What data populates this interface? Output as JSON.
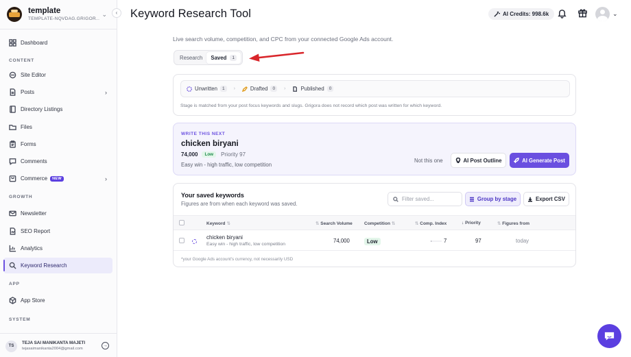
{
  "workspace": {
    "name": "template",
    "subtitle": "TEMPLATE-NQVDAG.GRIGOR..."
  },
  "sidebar": {
    "top_items": [
      {
        "label": "Dashboard",
        "icon": "dashboard-icon"
      }
    ],
    "sections": [
      {
        "label": "CONTENT",
        "items": [
          {
            "label": "Site Editor",
            "icon": "site-editor-icon"
          },
          {
            "label": "Posts",
            "icon": "posts-icon",
            "has_submenu": true
          },
          {
            "label": "Directory Listings",
            "icon": "directory-icon"
          },
          {
            "label": "Files",
            "icon": "folder-icon"
          },
          {
            "label": "Forms",
            "icon": "forms-icon"
          },
          {
            "label": "Comments",
            "icon": "comments-icon"
          },
          {
            "label": "Commerce",
            "icon": "commerce-icon",
            "badge": "NEW",
            "has_submenu": true
          }
        ]
      },
      {
        "label": "GROWTH",
        "items": [
          {
            "label": "Newsletter",
            "icon": "mail-icon"
          },
          {
            "label": "SEO Report",
            "icon": "seo-report-icon"
          },
          {
            "label": "Analytics",
            "icon": "analytics-icon"
          },
          {
            "label": "Keyword Research",
            "icon": "search-icon",
            "active": true
          }
        ]
      },
      {
        "label": "APP",
        "items": [
          {
            "label": "App Store",
            "icon": "app-store-icon"
          }
        ]
      },
      {
        "label": "SYSTEM",
        "items": []
      }
    ],
    "user": {
      "initials": "TS",
      "name": "TEJA SAI MANIKANTA MAJETI",
      "email": "tejasaimanikanta2004@gmail.com"
    }
  },
  "header": {
    "title": "Keyword Research Tool",
    "credits": "AI Credits: 998.6k"
  },
  "subtitle": "Live search volume, competition, and CPC from your connected Google Ads account.",
  "tabs": [
    {
      "label": "Research"
    },
    {
      "label": "Saved",
      "count": "1",
      "active": true
    }
  ],
  "stages": {
    "items": [
      {
        "label": "Unwritten",
        "count": "1"
      },
      {
        "label": "Drafted",
        "count": "0"
      },
      {
        "label": "Published",
        "count": "0"
      }
    ],
    "note": "Stage is matched from your post focus keywords and slugs. Grigora does not record which post was written for which keyword."
  },
  "next": {
    "eyebrow": "WRITE THIS NEXT",
    "keyword": "chicken biryani",
    "volume": "74,000",
    "competition": "Low",
    "priority": "Priority 97",
    "description": "Easy win - high traffic, low competition",
    "not_this": "Not this one",
    "outline_label": "AI Post Outline",
    "generate_label": "AI Generate Post"
  },
  "saved": {
    "title": "Your saved keywords",
    "subtitle": "Figures are from when each keyword was saved.",
    "filter_placeholder": "Filter saved...",
    "group_label": "Group by stage",
    "export_label": "Export CSV",
    "columns": [
      "Keyword",
      "Search Volume",
      "Competition",
      "Comp. Index",
      "Priority",
      "Figures from"
    ],
    "rows": [
      {
        "keyword": "chicken biryani",
        "description": "Easy win - high traffic, low competition",
        "volume": "74,000",
        "competition": "Low",
        "comp_index": "7",
        "priority": "97",
        "figures_from": "today"
      }
    ],
    "footnote": "*your Google Ads account's currency, not necessarily USD"
  },
  "colors": {
    "accent": "#6a4fe0",
    "low_badge_bg": "#e3f6ea",
    "low_badge_text": "#1d8a4c",
    "annotation_arrow": "#d9262b"
  }
}
